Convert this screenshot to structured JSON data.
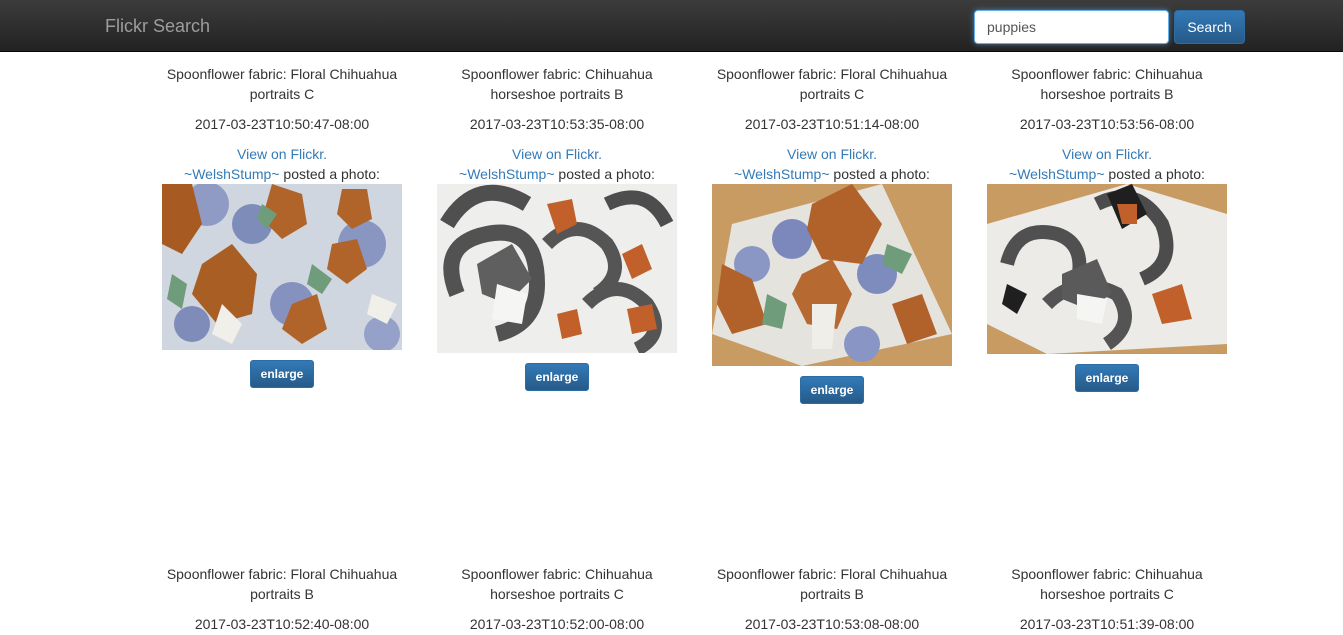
{
  "navbar": {
    "brand": "Flickr Search",
    "search_value": "puppies",
    "search_button": "Search"
  },
  "row1": [
    {
      "title": "Spoonflower fabric: Floral Chihuahua portraits C",
      "date": "2017-03-23T10:50:47-08:00",
      "view_link": "View on Flickr.",
      "author": "~WelshStump~",
      "posted": " posted a photo:",
      "enlarge": "enlarge"
    },
    {
      "title": "Spoonflower fabric: Chihuahua horseshoe portraits B",
      "date": "2017-03-23T10:53:35-08:00",
      "view_link": "View on Flickr.",
      "author": "~WelshStump~",
      "posted": " posted a photo:",
      "enlarge": "enlarge"
    },
    {
      "title": "Spoonflower fabric: Floral Chihuahua portraits C",
      "date": "2017-03-23T10:51:14-08:00",
      "view_link": "View on Flickr.",
      "author": "~WelshStump~",
      "posted": " posted a photo:",
      "enlarge": "enlarge"
    },
    {
      "title": "Spoonflower fabric: Chihuahua horseshoe portraits B",
      "date": "2017-03-23T10:53:56-08:00",
      "view_link": "View on Flickr.",
      "author": "~WelshStump~",
      "posted": " posted a photo:",
      "enlarge": "enlarge"
    }
  ],
  "row2": [
    {
      "title": "Spoonflower fabric: Floral Chihuahua portraits B",
      "date": "2017-03-23T10:52:40-08:00"
    },
    {
      "title": "Spoonflower fabric: Chihuahua horseshoe portraits C",
      "date": "2017-03-23T10:52:00-08:00"
    },
    {
      "title": "Spoonflower fabric: Floral Chihuahua portraits B",
      "date": "2017-03-23T10:53:08-08:00"
    },
    {
      "title": "Spoonflower fabric: Chihuahua horseshoe portraits C",
      "date": "2017-03-23T10:51:39-08:00"
    }
  ]
}
